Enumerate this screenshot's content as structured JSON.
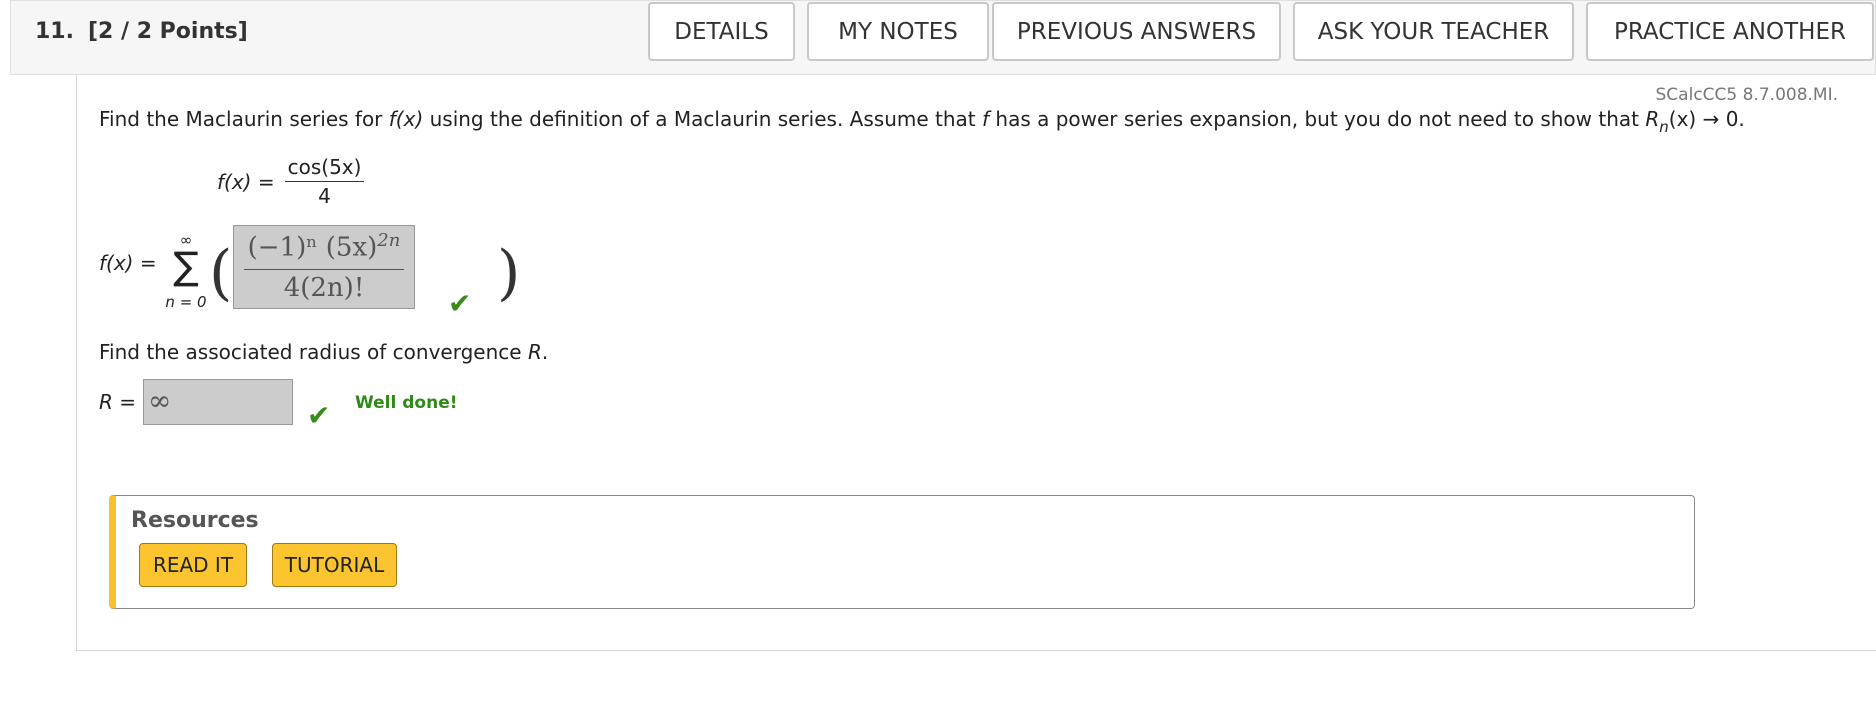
{
  "header": {
    "question_number": "11.",
    "points": "[2 / 2 Points]",
    "buttons": {
      "details": "DETAILS",
      "my_notes": "MY NOTES",
      "previous_answers": "PREVIOUS ANSWERS",
      "ask_teacher": "ASK YOUR TEACHER",
      "practice_another": "PRACTICE ANOTHER"
    }
  },
  "problem": {
    "code": "SCalcCC5 8.7.008.MI.",
    "prompt_part1": "Find the Maclaurin series for ",
    "prompt_fx": "f(x)",
    "prompt_part2": " using the definition of a Maclaurin series. Assume that ",
    "prompt_f": "f",
    "prompt_part3": " has a power series expansion, but you do not need to show that ",
    "prompt_R": "R",
    "prompt_n": "n",
    "prompt_part4": "(x) → 0.",
    "function_label": "f(x) =",
    "function_numerator": "cos(5x)",
    "function_denominator": "4",
    "series_label": "f(x) =",
    "sum_upper": "∞",
    "sum_lower": "n = 0",
    "answer1": {
      "numerator": "(−1)ⁿ (5x)",
      "exponent": "2n",
      "denominator": "4(2n)!",
      "status": "correct"
    },
    "question2": "Find the associated radius of convergence ",
    "question2_R": "R",
    "question2_end": ".",
    "r_label": "R =",
    "answer2": {
      "value": "∞",
      "status": "correct"
    },
    "feedback": "Well done!"
  },
  "resources": {
    "title": "Resources",
    "read_it": "READ IT",
    "tutorial": "TUTORIAL"
  },
  "colors": {
    "check": "#3a8a1c",
    "feedback": "#2f8a17",
    "resource_accent": "#f5c12e",
    "resource_button": "#fcc530"
  }
}
